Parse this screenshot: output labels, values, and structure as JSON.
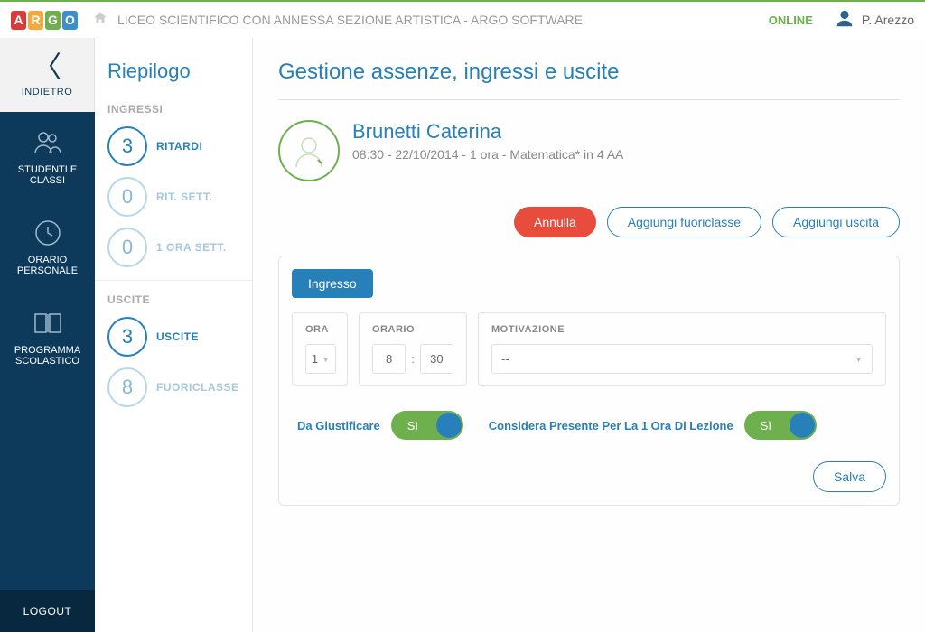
{
  "topbar": {
    "logo": [
      "A",
      "R",
      "G",
      "O"
    ],
    "school": "LICEO SCIENTIFICO CON ANNESSA SEZIONE ARTISTICA - ARGO SOFTWARE",
    "status": "ONLINE",
    "user": "P. Arezzo"
  },
  "nav": {
    "back": "INDIETRO",
    "items": [
      {
        "label": "STUDENTI E CLASSI"
      },
      {
        "label": "ORARIO PERSONALE"
      },
      {
        "label": "PROGRAMMA SCOLASTICO"
      }
    ],
    "logout": "LOGOUT"
  },
  "riepilogo": {
    "title": "Riepilogo",
    "ingressi_label": "INGRESSI",
    "stats_ingressi": [
      {
        "value": "3",
        "label": "RITARDI",
        "strong": true
      },
      {
        "value": "0",
        "label": "RIT. SETT.",
        "strong": false
      },
      {
        "value": "0",
        "label": "1 ORA SETT.",
        "strong": false
      }
    ],
    "uscite_label": "USCITE",
    "stats_uscite": [
      {
        "value": "3",
        "label": "USCITE",
        "strong": true
      },
      {
        "value": "8",
        "label": "FUORICLASSE",
        "strong": false
      }
    ]
  },
  "main": {
    "title": "Gestione assenze, ingressi e uscite",
    "student_name": "Brunetti Caterina",
    "student_meta": "08:30 - 22/10/2014 - 1 ora - Matematica* in 4 AA",
    "btn_annulla": "Annulla",
    "btn_fuoriclasse": "Aggiungi fuoriclasse",
    "btn_uscita": "Aggiungi uscita",
    "tab_ingresso": "Ingresso",
    "form": {
      "ora_label": "ORA",
      "ora_value": "1",
      "orario_label": "ORARIO",
      "orario_h": "8",
      "orario_m": "30",
      "motiv_label": "MOTIVAZIONE",
      "motiv_value": "--"
    },
    "toggles": {
      "giustificare_label": "Da Giustificare",
      "giustificare_value": "Sì",
      "presente_label": "Considera Presente Per La 1 Ora Di Lezione",
      "presente_value": "Sì"
    },
    "btn_salva": "Salva"
  }
}
